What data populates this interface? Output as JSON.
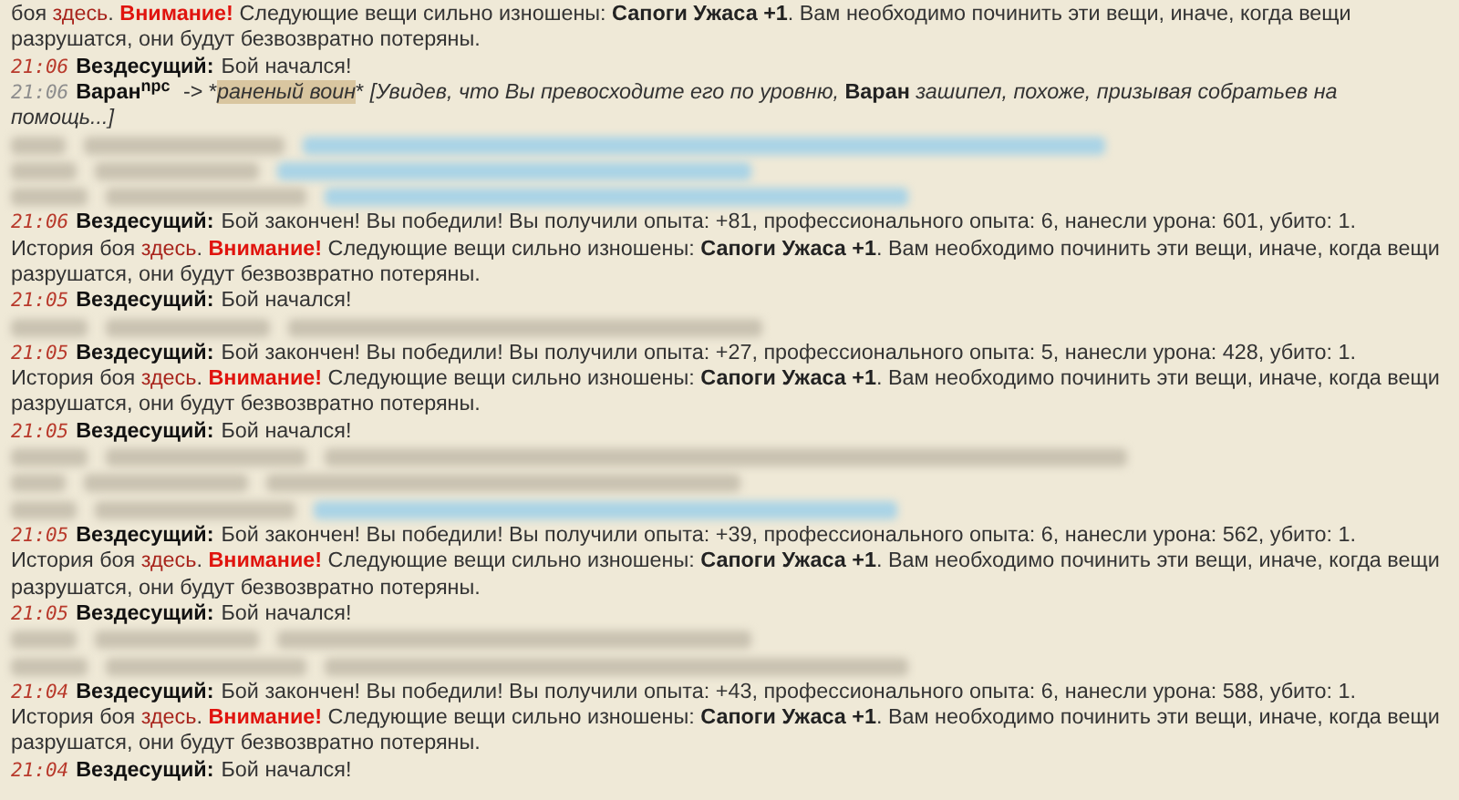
{
  "messages": [
    {
      "kind": "continuation",
      "segments": [
        {
          "kind": "text",
          "text": "боя "
        },
        {
          "kind": "link",
          "text": "здесь"
        },
        {
          "kind": "text",
          "text": ". "
        },
        {
          "kind": "warning",
          "text": "Внимание!"
        },
        {
          "kind": "text",
          "text": " Следующие вещи сильно изношены: "
        },
        {
          "kind": "bold",
          "text": "Сапоги Ужаса +1"
        },
        {
          "kind": "text",
          "text": ". Вам необходимо починить эти вещи, иначе, когда вещи разрушатся, они будут безвозвратно потеряны."
        }
      ]
    },
    {
      "kind": "system",
      "time": "21:06",
      "author": "Вездесущий:",
      "segments": [
        {
          "kind": "text",
          "text": "Бой начался!"
        }
      ]
    },
    {
      "kind": "speech",
      "time": "21:06",
      "author": "Варан$^{npc}$",
      "segments": [
        {
          "kind": "text",
          "text": " -> *"
        },
        {
          "kind": "target",
          "text": "раненый воин"
        },
        {
          "kind": "text",
          "text": "* "
        },
        {
          "kind": "italic",
          "text": "[Увидев, что Вы превосходите его по уровню, "
        },
        {
          "kind": "bold",
          "text": "Варан"
        },
        {
          "kind": "italic",
          "text": " зашипел, похоже, призывая собратьев на"
        },
        {
          "kind": "break"
        },
        {
          "kind": "italic",
          "text": "помощь...]"
        }
      ]
    },
    {
      "kind": "redacted",
      "highlighted": true
    },
    {
      "kind": "redacted",
      "highlighted": true
    },
    {
      "kind": "redacted",
      "highlighted": true
    },
    {
      "kind": "system",
      "time": "21:06",
      "author": "Вездесущий:",
      "segments": [
        {
          "kind": "text",
          "text": "Бой закончен! Вы победили! Вы получили опыта: +81, профессионального опыта: 6, нанесли урона: 601, убито: 1."
        },
        {
          "kind": "break"
        },
        {
          "kind": "text",
          "text": "История боя "
        },
        {
          "kind": "link",
          "text": "здесь"
        },
        {
          "kind": "text",
          "text": ". "
        },
        {
          "kind": "warning",
          "text": "Внимание!"
        },
        {
          "kind": "text",
          "text": " Следующие вещи сильно изношены: "
        },
        {
          "kind": "bold",
          "text": "Сапоги Ужаса +1"
        },
        {
          "kind": "text",
          "text": ". Вам необходимо починить эти вещи, иначе, когда вещи разрушатся, они будут безвозвратно потеряны."
        }
      ]
    },
    {
      "kind": "system",
      "time": "21:05",
      "author": "Вездесущий:",
      "segments": [
        {
          "kind": "text",
          "text": "Бой начался!"
        }
      ]
    },
    {
      "kind": "redacted",
      "highlighted": false
    },
    {
      "kind": "system",
      "time": "21:05",
      "author": "Вездесущий:",
      "segments": [
        {
          "kind": "text",
          "text": "Бой закончен! Вы победили! Вы получили опыта: +27, профессионального опыта: 5, нанесли урона: 428, убито: 1."
        },
        {
          "kind": "break"
        },
        {
          "kind": "text",
          "text": "История боя "
        },
        {
          "kind": "link",
          "text": "здесь"
        },
        {
          "kind": "text",
          "text": ". "
        },
        {
          "kind": "warning",
          "text": "Внимание!"
        },
        {
          "kind": "text",
          "text": " Следующие вещи сильно изношены: "
        },
        {
          "kind": "bold",
          "text": "Сапоги Ужаса +1"
        },
        {
          "kind": "text",
          "text": ". Вам необходимо починить эти вещи, иначе, когда вещи разрушатся, они будут безвозвратно потеряны."
        }
      ]
    },
    {
      "kind": "system",
      "time": "21:05",
      "author": "Вездесущий:",
      "segments": [
        {
          "kind": "text",
          "text": "Бой начался!"
        }
      ]
    },
    {
      "kind": "redacted",
      "highlighted": false
    },
    {
      "kind": "redacted",
      "highlighted": false
    },
    {
      "kind": "redacted",
      "highlighted": true
    },
    {
      "kind": "system",
      "time": "21:05",
      "author": "Вездесущий:",
      "segments": [
        {
          "kind": "text",
          "text": "Бой закончен! Вы победили! Вы получили опыта: +39, профессионального опыта: 6, нанесли урона: 562, убито: 1."
        },
        {
          "kind": "break"
        },
        {
          "kind": "text",
          "text": "История боя "
        },
        {
          "kind": "link",
          "text": "здесь"
        },
        {
          "kind": "text",
          "text": ". "
        },
        {
          "kind": "warning",
          "text": "Внимание!"
        },
        {
          "kind": "text",
          "text": " Следующие вещи сильно изношены: "
        },
        {
          "kind": "bold",
          "text": "Сапоги Ужаса +1"
        },
        {
          "kind": "text",
          "text": ". Вам необходимо починить эти вещи, иначе, когда вещи разрушатся, они будут безвозвратно потеряны."
        }
      ]
    },
    {
      "kind": "system",
      "time": "21:05",
      "author": "Вездесущий:",
      "segments": [
        {
          "kind": "text",
          "text": "Бой начался!"
        }
      ]
    },
    {
      "kind": "redacted",
      "highlighted": false
    },
    {
      "kind": "redacted",
      "highlighted": false
    },
    {
      "kind": "system",
      "time": "21:04",
      "author": "Вездесущий:",
      "segments": [
        {
          "kind": "text",
          "text": "Бой закончен! Вы победили! Вы получили опыта: +43, профессионального опыта: 6, нанесли урона: 588, убито: 1."
        },
        {
          "kind": "break"
        },
        {
          "kind": "text",
          "text": "История боя "
        },
        {
          "kind": "link",
          "text": "здесь"
        },
        {
          "kind": "text",
          "text": ". "
        },
        {
          "kind": "warning",
          "text": "Внимание!"
        },
        {
          "kind": "text",
          "text": " Следующие вещи сильно изношены: "
        },
        {
          "kind": "bold",
          "text": "Сапоги Ужаса +1"
        },
        {
          "kind": "text",
          "text": ". Вам необходимо починить эти вещи, иначе, когда вещи разрушатся, они будут безвозвратно потеряны."
        }
      ]
    },
    {
      "kind": "system",
      "time": "21:04",
      "author": "Вездесущий:",
      "segments": [
        {
          "kind": "text",
          "text": "Бой начался!"
        }
      ]
    }
  ]
}
